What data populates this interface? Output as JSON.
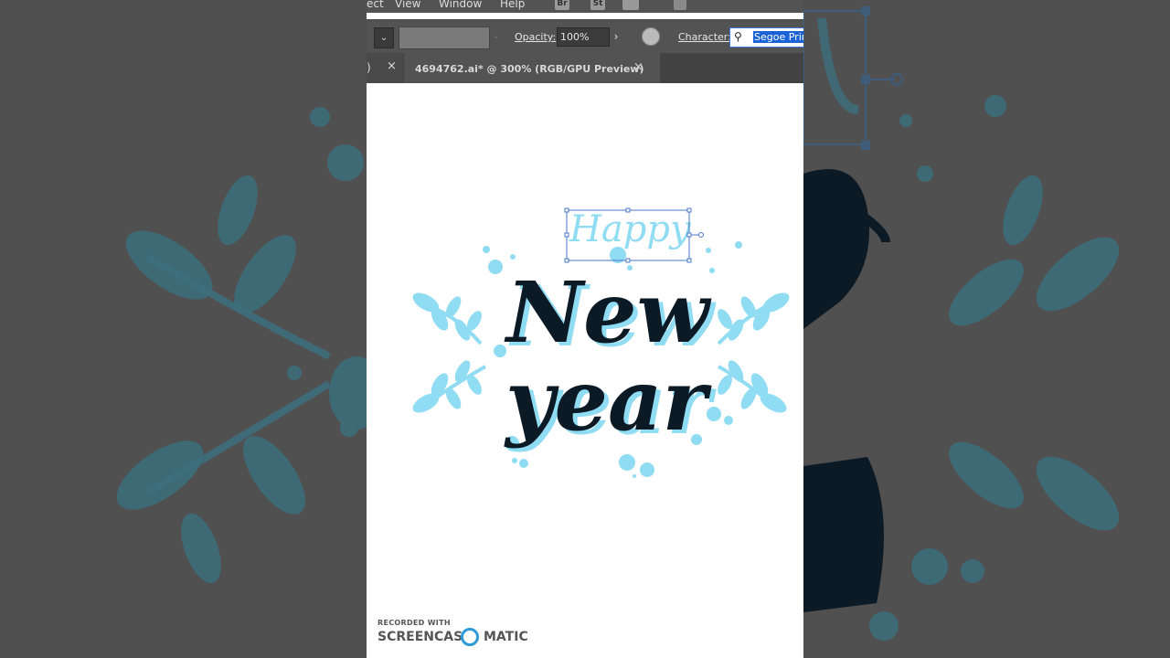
{
  "menu": {
    "items": [
      "ect",
      "View",
      "Window",
      "Help"
    ],
    "toolbar_icons": [
      "Br",
      "St"
    ]
  },
  "control_bar": {
    "opacity_label": "Opacity:",
    "opacity_value": "100%",
    "character_label": "Character:",
    "font_value": "Segoe Print"
  },
  "tabs": [
    {
      "label": ")",
      "close": "×"
    },
    {
      "label": "4694762.ai* @ 300% (RGB/GPU Preview)",
      "close": "×"
    }
  ],
  "artwork": {
    "top_text": "Happy",
    "line1": "New",
    "line2": "year",
    "colors": {
      "accent": "#8fdcf3",
      "ink": "#0c1a26",
      "selection": "#4a78c9"
    }
  },
  "watermark": {
    "top": "RECORDED WITH",
    "left": "SCREENCAST",
    "right": "MATIC"
  }
}
